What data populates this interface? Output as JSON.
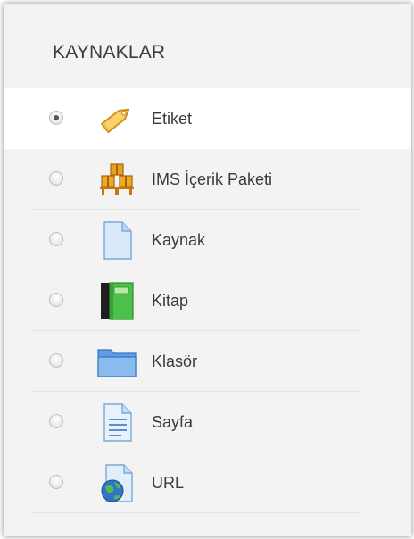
{
  "panel": {
    "heading": "KAYNAKLAR"
  },
  "items": [
    {
      "label": "Etiket",
      "icon": "tag-icon",
      "selected": true
    },
    {
      "label": "IMS İçerik Paketi",
      "icon": "boxes-icon",
      "selected": false
    },
    {
      "label": "Kaynak",
      "icon": "file-icon",
      "selected": false
    },
    {
      "label": "Kitap",
      "icon": "book-icon",
      "selected": false
    },
    {
      "label": "Klasör",
      "icon": "folder-icon",
      "selected": false
    },
    {
      "label": "Sayfa",
      "icon": "page-icon",
      "selected": false
    },
    {
      "label": "URL",
      "icon": "url-globe-icon",
      "selected": false
    }
  ],
  "colors": {
    "panel_bg": "#f3f3f3",
    "selected_bg": "#ffffff",
    "text": "#3a3a3a"
  }
}
